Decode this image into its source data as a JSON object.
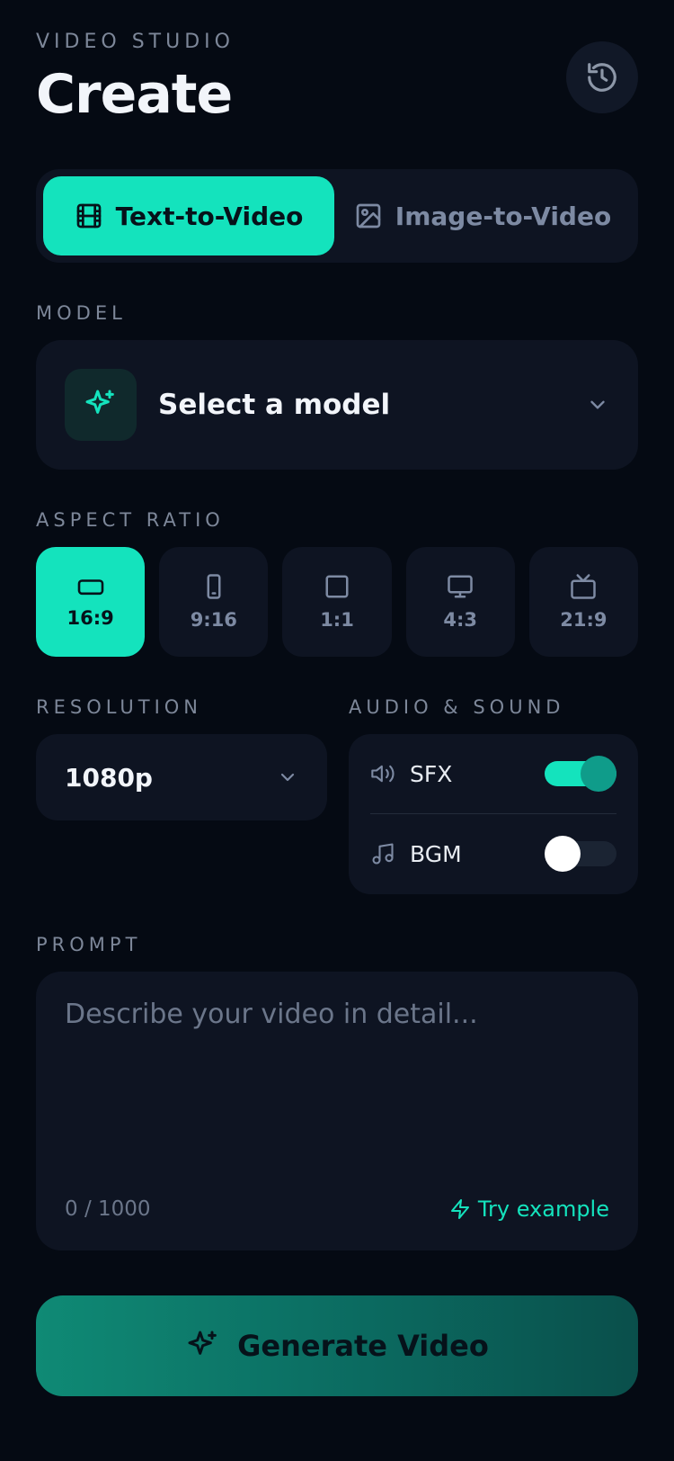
{
  "header": {
    "eyebrow": "VIDEO STUDIO",
    "title": "Create",
    "history_icon": "history-icon"
  },
  "mode_switch": {
    "tabs": [
      {
        "label": "Text-to-Video",
        "icon": "film-icon",
        "active": true
      },
      {
        "label": "Image-to-Video",
        "icon": "image-icon",
        "active": false
      }
    ]
  },
  "model": {
    "section_label": "MODEL",
    "placeholder": "Select a model",
    "icon": "sparkles-icon"
  },
  "aspect_ratio": {
    "section_label": "ASPECT RATIO",
    "selected": "16:9",
    "options": [
      {
        "label": "16:9",
        "icon": "landscape-icon"
      },
      {
        "label": "9:16",
        "icon": "portrait-icon"
      },
      {
        "label": "1:1",
        "icon": "square-icon"
      },
      {
        "label": "4:3",
        "icon": "monitor-icon"
      },
      {
        "label": "21:9",
        "icon": "tv-icon"
      }
    ]
  },
  "resolution": {
    "section_label": "RESOLUTION",
    "value": "1080p"
  },
  "audio": {
    "section_label": "AUDIO & SOUND",
    "items": [
      {
        "label": "SFX",
        "icon": "speaker-icon",
        "enabled": true
      },
      {
        "label": "BGM",
        "icon": "music-icon",
        "enabled": false
      }
    ]
  },
  "prompt": {
    "section_label": "PROMPT",
    "placeholder": "Describe your video in detail...",
    "counter": "0 / 1000",
    "try_example": "Try example"
  },
  "generate": {
    "label": "Generate Video"
  },
  "colors": {
    "accent": "#14e3bd",
    "background": "#050a13",
    "card": "#0e1422"
  }
}
